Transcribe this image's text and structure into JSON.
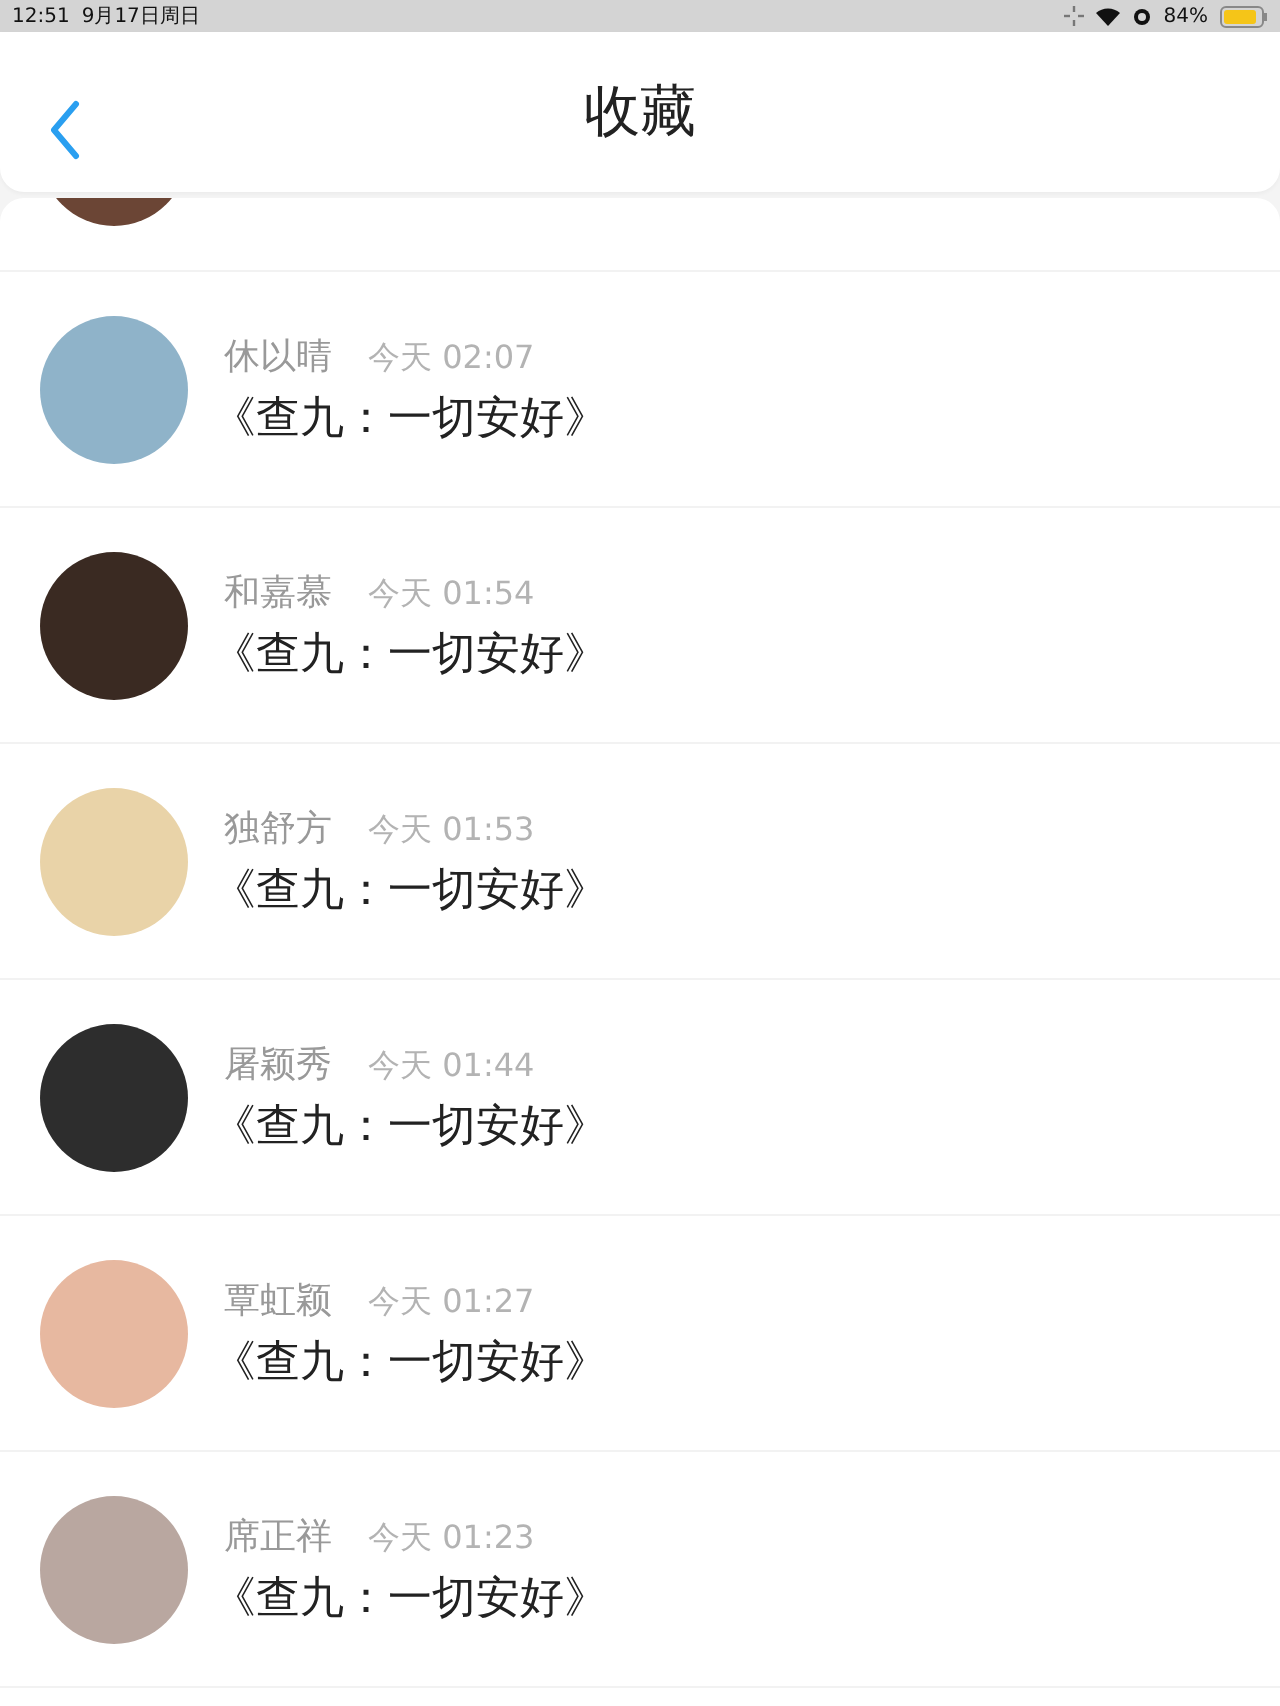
{
  "status_bar": {
    "time": "12:51",
    "date": "9月17日周日",
    "battery": "84%"
  },
  "header": {
    "title": "收藏"
  },
  "items": [
    {
      "name": "休以晴",
      "time": "今天 02:07",
      "title": "《查九：一切安好》"
    },
    {
      "name": "和嘉慕",
      "time": "今天 01:54",
      "title": "《查九：一切安好》"
    },
    {
      "name": "独舒方",
      "time": "今天 01:53",
      "title": "《查九：一切安好》"
    },
    {
      "name": "屠颖秀",
      "time": "今天 01:44",
      "title": "《查九：一切安好》"
    },
    {
      "name": "覃虹颖",
      "time": "今天 01:27",
      "title": "《查九：一切安好》"
    },
    {
      "name": "席正祥",
      "time": "今天 01:23",
      "title": "《查九：一切安好》"
    }
  ]
}
